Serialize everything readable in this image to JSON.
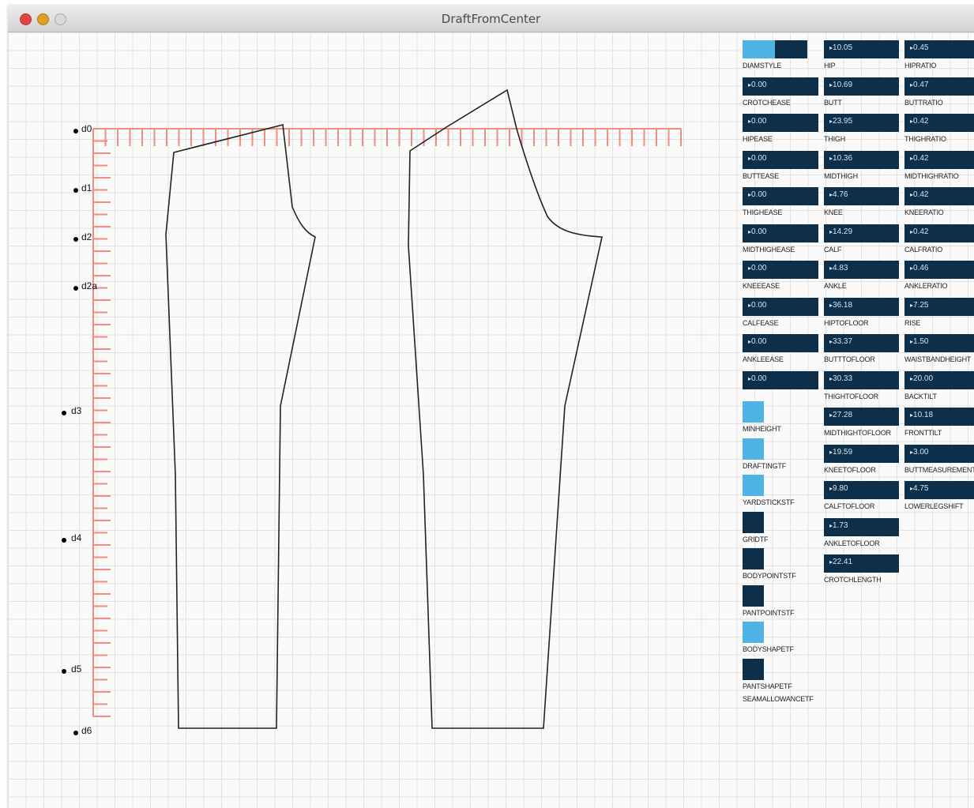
{
  "window": {
    "title": "DraftFromCenter"
  },
  "colors": {
    "panel_dark": "#0d2f4a",
    "panel_accent": "#4fb3e3",
    "ruler": "#f08c80",
    "grid": "#e2e2e2"
  },
  "markers": [
    "d0",
    "d1",
    "d2",
    "d2a",
    "d3",
    "d4",
    "d5",
    "d6"
  ],
  "col1": {
    "first_slider": {
      "label": "DIAMSTYLE",
      "fraction": 0.5
    },
    "sliders": [
      {
        "label": "CROTCHEASE",
        "value": "0.00"
      },
      {
        "label": "HIPEASE",
        "value": "0.00"
      },
      {
        "label": "BUTTEASE",
        "value": "0.00"
      },
      {
        "label": "THIGHEASE",
        "value": "0.00"
      },
      {
        "label": "MIDTHIGHEASE",
        "value": "0.00"
      },
      {
        "label": "KNEEEASE",
        "value": "0.00"
      },
      {
        "label": "CALFEASE",
        "value": "0.00"
      },
      {
        "label": "ANKLEEASE",
        "value": "0.00"
      },
      {
        "label": "",
        "value": "0.00"
      }
    ],
    "toggles": [
      {
        "label": "MINHEIGHT",
        "on": true
      },
      {
        "label": "DRAFTINGTF",
        "on": true
      },
      {
        "label": "YARDSTICKSTF",
        "on": true
      },
      {
        "label": "GRIDTF",
        "on": false
      },
      {
        "label": "BODYPOINTSTF",
        "on": false
      },
      {
        "label": "PANTPOINTSTF",
        "on": false
      },
      {
        "label": "BODYSHAPETF",
        "on": true
      },
      {
        "label": "PANTSHAPETF",
        "on": false
      },
      {
        "label": "SEAMALLOWANCETF",
        "on": null
      }
    ]
  },
  "col2": {
    "sliders": [
      {
        "label": "HIP",
        "value": "10.05"
      },
      {
        "label": "BUTT",
        "value": "10.69"
      },
      {
        "label": "THIGH",
        "value": "23.95"
      },
      {
        "label": "MIDTHIGH",
        "value": "10.36"
      },
      {
        "label": "KNEE",
        "value": "4.76"
      },
      {
        "label": "CALF",
        "value": "14.29"
      },
      {
        "label": "ANKLE",
        "value": "4.83"
      },
      {
        "label": "HIPTOFLOOR",
        "value": "36.18"
      },
      {
        "label": "BUTTTOFLOOR",
        "value": "33.37"
      },
      {
        "label": "THIGHTOFLOOR",
        "value": "30.33"
      },
      {
        "label": "MIDTHIGHTOFLOOR",
        "value": "27.28"
      },
      {
        "label": "KNEETOFLOOR",
        "value": "19.59"
      },
      {
        "label": "CALFTOFLOOR",
        "value": "9.80"
      },
      {
        "label": "ANKLETOFLOOR",
        "value": "1.73"
      },
      {
        "label": "CROTCHLENGTH",
        "value": "22.41"
      }
    ]
  },
  "col3": {
    "sliders": [
      {
        "label": "HIPRATIO",
        "value": "0.45"
      },
      {
        "label": "BUTTRATIO",
        "value": "0.47"
      },
      {
        "label": "THIGHRATIO",
        "value": "0.42"
      },
      {
        "label": "MIDTHIGHRATIO",
        "value": "0.42"
      },
      {
        "label": "KNEERATIO",
        "value": "0.42"
      },
      {
        "label": "CALFRATIO",
        "value": "0.42"
      },
      {
        "label": "ANKLERATIO",
        "value": "0.46"
      },
      {
        "label": "RISE",
        "value": "7.25"
      },
      {
        "label": "WAISTBANDHEIGHT",
        "value": "1.50"
      },
      {
        "label": "BACKTILT",
        "value": "20.00"
      },
      {
        "label": "FRONTTILT",
        "value": "10.18"
      },
      {
        "label": "BUTTMEASUREMENT",
        "value": "3.00"
      },
      {
        "label": "LOWERLEGSHIFT",
        "value": "4.75"
      }
    ]
  }
}
